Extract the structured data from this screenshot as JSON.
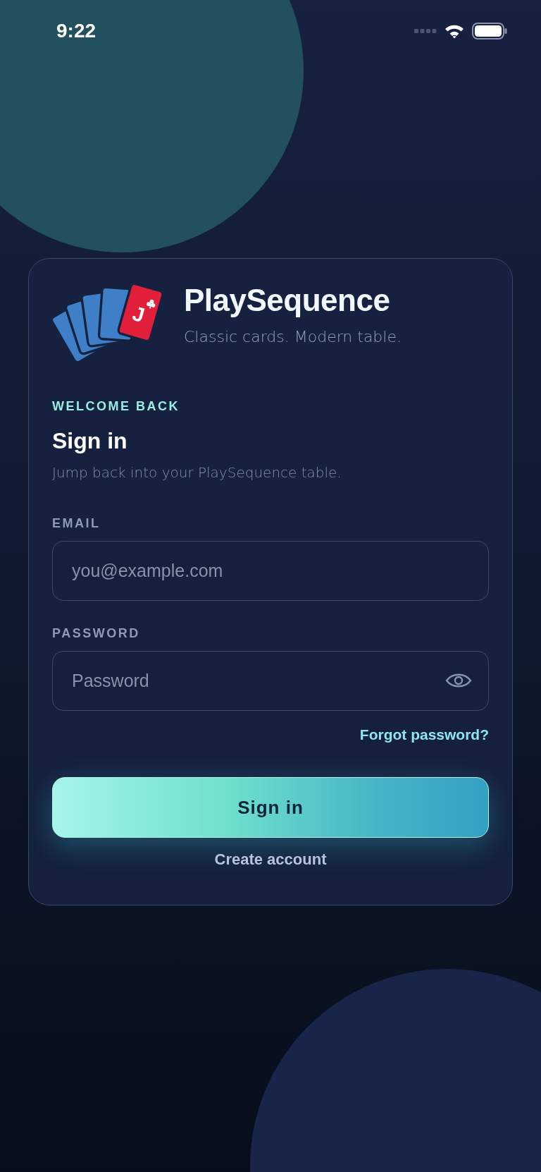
{
  "status_bar": {
    "time": "9:22"
  },
  "brand": {
    "name": "PlaySequence",
    "tagline": "Classic cards. Modern table.",
    "card_letter": "J"
  },
  "heading": {
    "eyebrow": "WELCOME BACK",
    "title": "Sign in",
    "subtitle": "Jump back into your PlaySequence table."
  },
  "fields": [
    {
      "label": "EMAIL",
      "placeholder": "you@example.com",
      "kind": "email"
    },
    {
      "label": "PASSWORD",
      "placeholder": "Password",
      "kind": "password"
    }
  ],
  "forgot_link": "Forgot password?",
  "primary_button": "Sign in",
  "secondary_link": "Create account"
}
